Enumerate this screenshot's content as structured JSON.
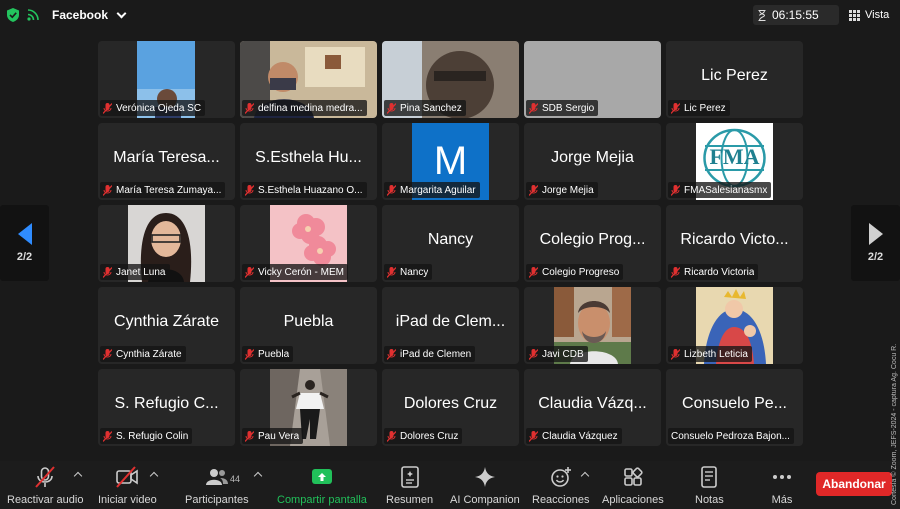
{
  "topbar": {
    "app_name": "Facebook",
    "timer": "06:15:55",
    "view_label": "Vista"
  },
  "pagination": {
    "left": "2/2",
    "right": "2/2"
  },
  "tiles": [
    {
      "name": "Verónica Ojeda SC",
      "big": ""
    },
    {
      "name": "delfina medina medra...",
      "big": ""
    },
    {
      "name": "Pina Sanchez",
      "big": ""
    },
    {
      "name": "SDB Sergio",
      "big": ""
    },
    {
      "name": "Lic Perez",
      "big": "Lic Perez"
    },
    {
      "name": "María Teresa Zumaya...",
      "big": "María Teresa..."
    },
    {
      "name": "S.Esthela Huazano O...",
      "big": "S.Esthela Hu..."
    },
    {
      "name": "Margarita Aguilar",
      "big": "",
      "initial": "M"
    },
    {
      "name": "Jorge Mejia",
      "big": "Jorge Mejia"
    },
    {
      "name": "FMASalesianasmx",
      "big": "",
      "logo_text": "FMA"
    },
    {
      "name": "Janet Luna",
      "big": ""
    },
    {
      "name": "Vicky Cerón - MEM",
      "big": ""
    },
    {
      "name": "Nancy",
      "big": "Nancy"
    },
    {
      "name": "Colegio Progreso",
      "big": "Colegio Prog..."
    },
    {
      "name": "Ricardo Victoria",
      "big": "Ricardo Victo..."
    },
    {
      "name": "Cynthia Zárate",
      "big": "Cynthia Zárate"
    },
    {
      "name": "Puebla",
      "big": "Puebla"
    },
    {
      "name": "iPad de Clemen",
      "big": "iPad de Clem..."
    },
    {
      "name": "Javi CDB",
      "big": ""
    },
    {
      "name": "Lizbeth Leticia",
      "big": ""
    },
    {
      "name": "S. Refugio Colin",
      "big": "S. Refugio C..."
    },
    {
      "name": "Pau Vera",
      "big": ""
    },
    {
      "name": "Dolores Cruz",
      "big": "Dolores Cruz"
    },
    {
      "name": "Claudia Vázquez",
      "big": "Claudia Vázq..."
    },
    {
      "name": "Consuelo Pedroza Bajon...",
      "big": "Consuelo Pe..."
    }
  ],
  "toolbar": {
    "audio": "Reactivar audio",
    "video": "Iniciar video",
    "participants": "Participantes",
    "participants_count": "44",
    "share": "Compartir pantalla",
    "summary": "Resumen",
    "ai": "AI Companion",
    "reactions": "Reacciones",
    "apps": "Aplicaciones",
    "notes": "Notas",
    "more": "Más",
    "leave": "Abandonar"
  },
  "credit": "Cortesía © Zoom, JEFS-2024 - captura Ag. Cocu R.",
  "colors": {
    "accent_blue": "#2f8cff",
    "share_green": "#21c05a",
    "leave_red": "#e02828",
    "mute_red": "#e03030"
  }
}
